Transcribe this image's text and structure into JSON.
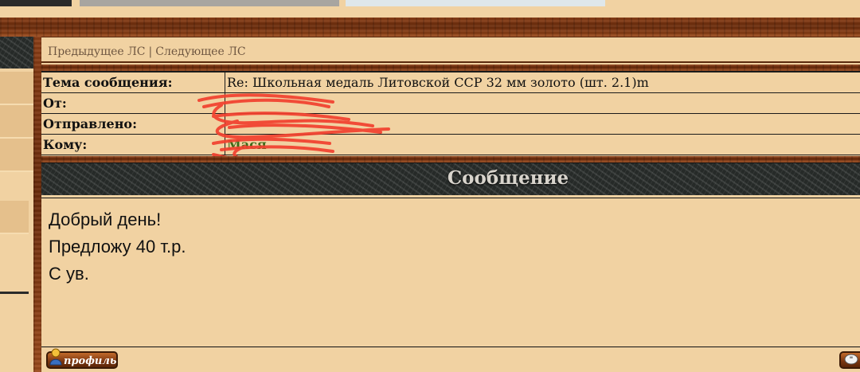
{
  "nav": {
    "prev_label": "Предыдущее ЛС",
    "separator": "|",
    "next_label": "Следующее ЛС"
  },
  "info": {
    "subject_label": "Тема сообщения:",
    "subject_value": "Re: Школьная медаль Литовской ССР 32 мм золото (шт. 2.1)m",
    "from_label": "От:",
    "from_value": "",
    "sent_label": "Отправлено:",
    "sent_value": "",
    "to_label": "Кому:",
    "to_value": "Мася"
  },
  "message": {
    "header": "Сообщение",
    "lines": [
      "Добрый день!",
      "Предложу 40 т.р.",
      "С ув."
    ]
  },
  "buttons": {
    "profile_label": "профиль",
    "quote_icon": "quote-icon"
  },
  "colors": {
    "page_bg": "#f1d2a2",
    "wood": "#7a3510",
    "recipient_name": "#3f6b1a",
    "redaction": "#f2402f"
  }
}
